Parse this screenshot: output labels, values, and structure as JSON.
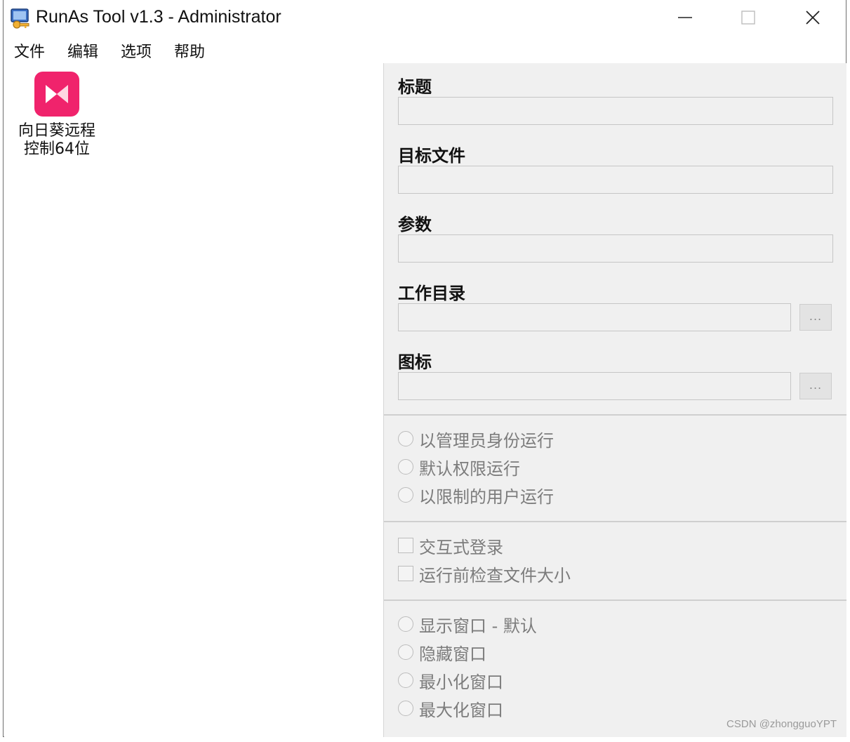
{
  "window": {
    "title": "RunAs Tool v1.3 - Administrator"
  },
  "menu": {
    "items": [
      {
        "label": "文件"
      },
      {
        "label": "编辑"
      },
      {
        "label": "选项"
      },
      {
        "label": "帮助"
      }
    ]
  },
  "shortcuts": [
    {
      "label": "向日葵远程\n控制64位",
      "icon": "sunlogin-icon",
      "icon_color": "#f0236c"
    }
  ],
  "fields": {
    "title": {
      "label": "标题",
      "value": ""
    },
    "target": {
      "label": "目标文件",
      "value": ""
    },
    "params": {
      "label": "参数",
      "value": ""
    },
    "workdir": {
      "label": "工作目录",
      "value": "",
      "browse": "..."
    },
    "icon": {
      "label": "图标",
      "value": "",
      "browse": "..."
    }
  },
  "run_mode": {
    "options": [
      {
        "label": "以管理员身份运行",
        "selected": false
      },
      {
        "label": "默认权限运行",
        "selected": false
      },
      {
        "label": "以限制的用户运行",
        "selected": false
      }
    ]
  },
  "checks": {
    "options": [
      {
        "label": "交互式登录",
        "checked": false
      },
      {
        "label": "运行前检查文件大小",
        "checked": false
      }
    ]
  },
  "window_mode": {
    "options": [
      {
        "label": "显示窗口 - 默认",
        "selected": false
      },
      {
        "label": "隐藏窗口",
        "selected": false
      },
      {
        "label": "最小化窗口",
        "selected": false
      },
      {
        "label": "最大化窗口",
        "selected": false
      }
    ]
  },
  "watermark": "CSDN @zhongguoYPT"
}
